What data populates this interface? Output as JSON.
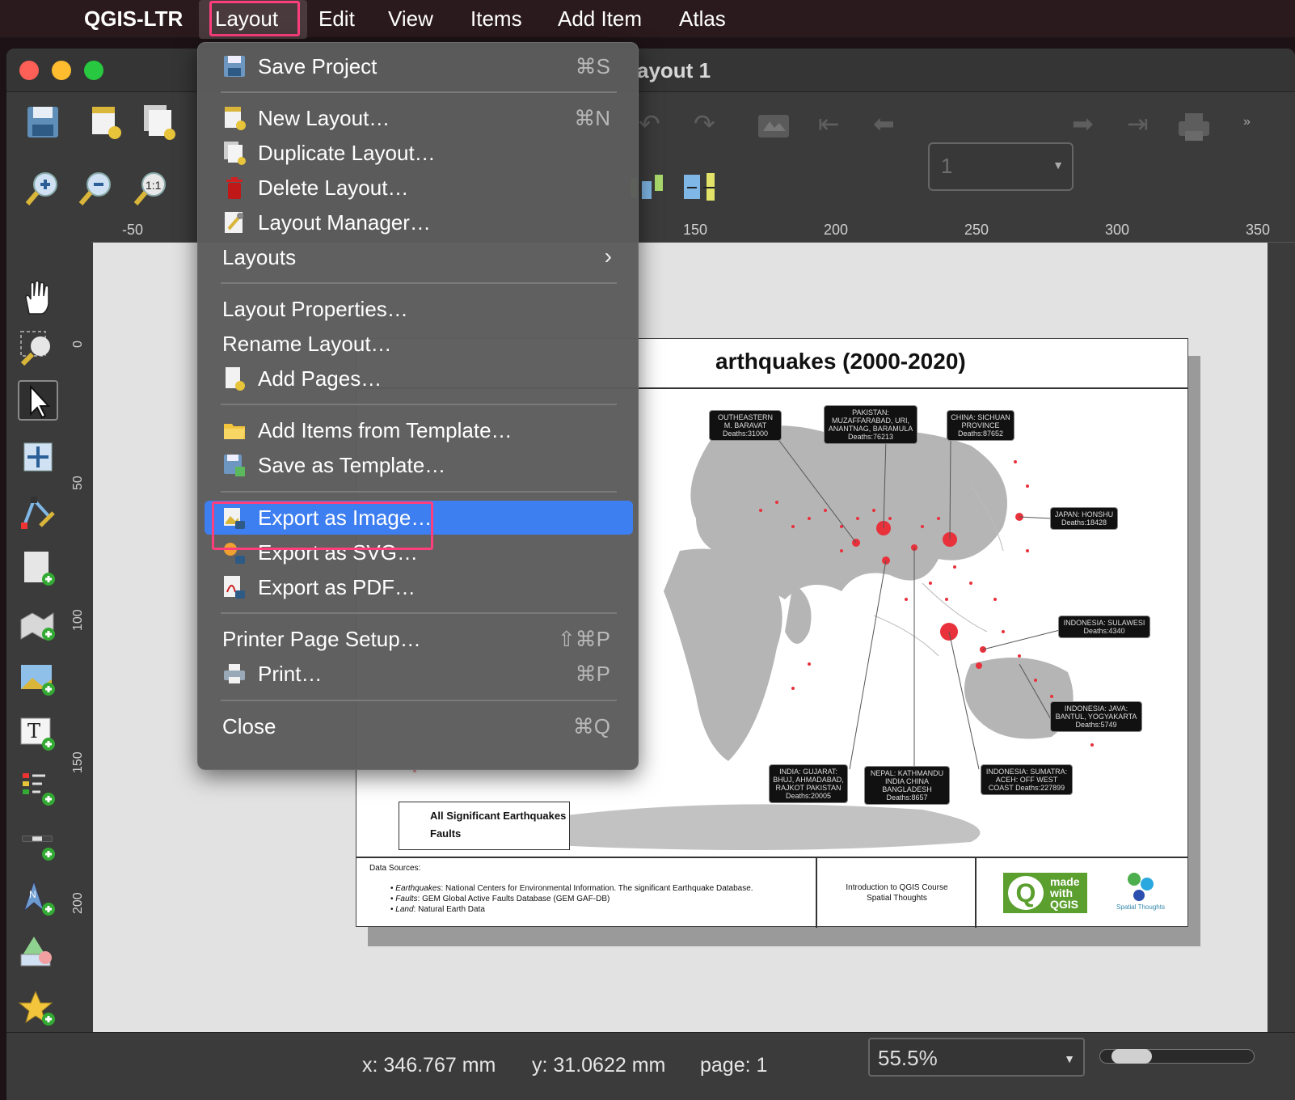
{
  "menubar": {
    "items": [
      "QGIS-LTR",
      "Layout",
      "Edit",
      "View",
      "Items",
      "Add Item",
      "Atlas"
    ]
  },
  "window": {
    "title": "ayout 1"
  },
  "toolbar": {
    "page_value": "1"
  },
  "ruler": {
    "h_ticks": [
      "-50",
      "150",
      "200",
      "250",
      "300",
      "350"
    ],
    "v_ticks": [
      "0",
      "50",
      "100",
      "150",
      "200"
    ]
  },
  "menu": {
    "items": [
      {
        "label": "Save Project",
        "shortcut": "⌘S",
        "icon": "save-icon"
      },
      {
        "label": "New Layout…",
        "shortcut": "⌘N",
        "icon": "new-layout-icon"
      },
      {
        "label": "Duplicate Layout…",
        "shortcut": "",
        "icon": "duplicate-layout-icon"
      },
      {
        "label": "Delete Layout…",
        "shortcut": "",
        "icon": "delete-icon"
      },
      {
        "label": "Layout Manager…",
        "shortcut": "",
        "icon": "layout-manager-icon"
      },
      {
        "label": "Layouts",
        "shortcut": "",
        "icon": ""
      },
      {
        "label": "Layout Properties…",
        "shortcut": "",
        "icon": ""
      },
      {
        "label": "Rename Layout…",
        "shortcut": "",
        "icon": ""
      },
      {
        "label": "Add Pages…",
        "shortcut": "",
        "icon": "add-pages-icon"
      },
      {
        "label": "Add Items from Template…",
        "shortcut": "",
        "icon": "folder-icon"
      },
      {
        "label": "Save as Template…",
        "shortcut": "",
        "icon": "save-template-icon"
      },
      {
        "label": "Export as Image…",
        "shortcut": "",
        "icon": "export-image-icon"
      },
      {
        "label": "Export as SVG…",
        "shortcut": "",
        "icon": "export-svg-icon"
      },
      {
        "label": "Export as PDF…",
        "shortcut": "",
        "icon": "export-pdf-icon"
      },
      {
        "label": "Printer Page Setup…",
        "shortcut": "⇧⌘P",
        "icon": ""
      },
      {
        "label": "Print…",
        "shortcut": "⌘P",
        "icon": "print-icon"
      },
      {
        "label": "Close",
        "shortcut": "⌘Q",
        "icon": ""
      }
    ]
  },
  "layout": {
    "title": "arthquakes (2000-2020)",
    "legend": [
      "All Significant Earthquakes",
      "Faults"
    ],
    "labels": [
      "OUTHEASTERN M. BARAVAT Deaths:31000",
      "PAKISTAN: MUZAFFARABAD, URI, ANANTNAG, BARAMULA Deaths:76213",
      "CHINA: SICHUAN PROVINCE Deaths:87652",
      "JAPAN: HONSHU Deaths:18428",
      "INDONESIA: SULAWESI Deaths:4340",
      "INDONESIA: JAVA: BANTUL, YOGYAKARTA Deaths:5749",
      "INDONESIA: SUMATRA: ACEH: OFF WEST COAST Deaths:227899",
      "NEPAL: KATHMANDU INDIA CHINA BANGLADESH Deaths:8657",
      "INDIA: GUJARAT: BHUJ, AHMADABAD, RAJKOT PAKISTAN Deaths:20005"
    ],
    "sources_title": "Data Sources:",
    "sources": [
      {
        "name": "Earthquakes",
        "text": ": National Centers for Environmental Information. The significant Earthquake Database."
      },
      {
        "name": "Faults",
        "text": ": GEM Global Active Faults Database (GEM GAF-DB)"
      },
      {
        "name": "Land",
        "text": ": Natural Earth Data"
      }
    ],
    "course": "Introduction to QGIS Course",
    "course_org": "Spatial Thoughts",
    "qgis_logo": "made with QGIS",
    "spatial_logo": "Spatial Thoughts"
  },
  "status": {
    "x": "x: 346.767 mm",
    "y": "y: 31.0622 mm",
    "page": "page: 1",
    "zoom": "55.5%",
    "zoom_slider_fraction": 0.1
  },
  "colors": {
    "highlight": "#ff3f7c",
    "menu_active": "#3d7ef0",
    "quake": "#e8313b"
  }
}
